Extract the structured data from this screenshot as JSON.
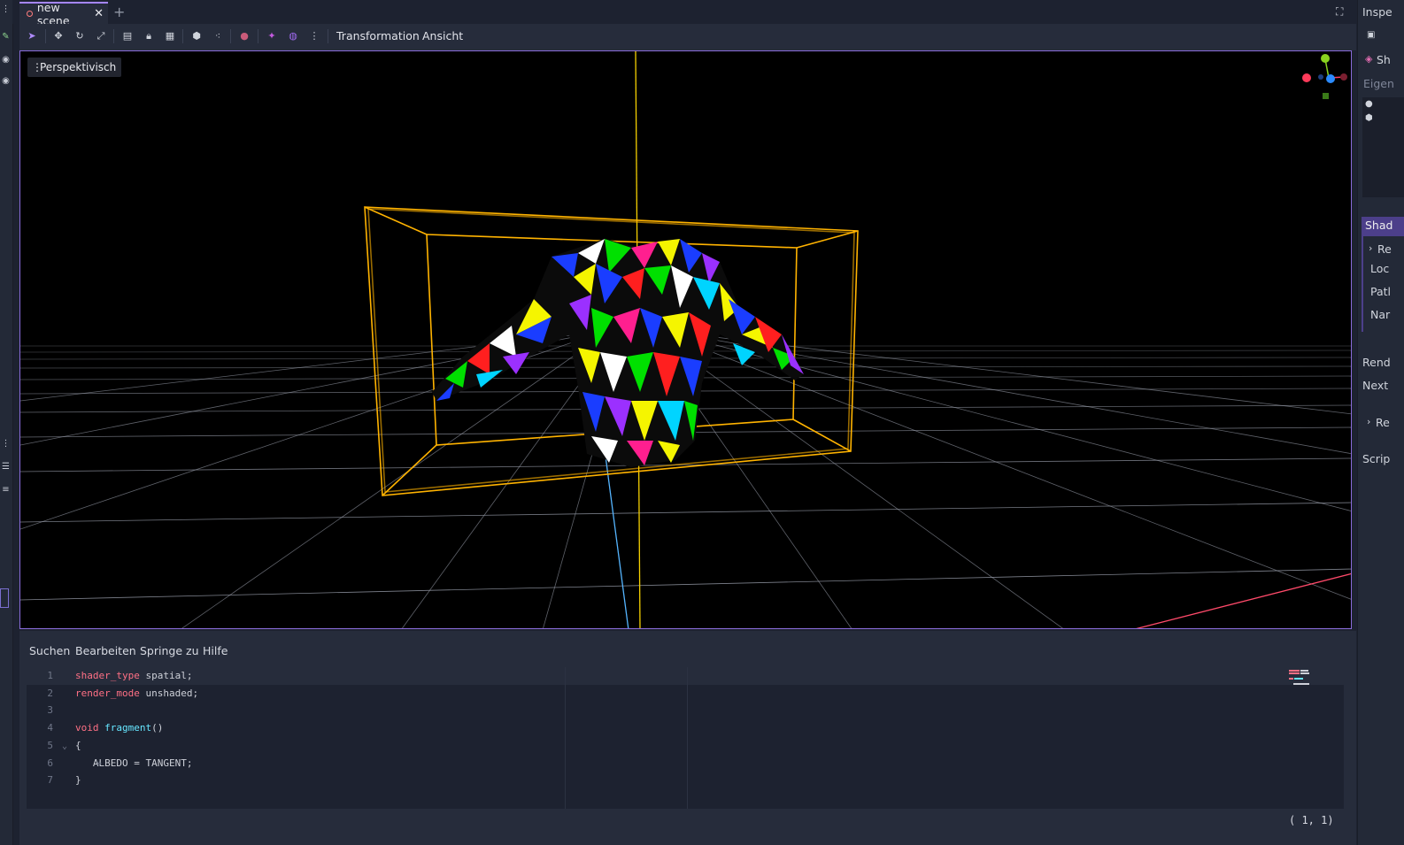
{
  "tabs": {
    "scene_tab_label": "new scene",
    "close_glyph": "✕",
    "add_glyph": "+"
  },
  "toolbar": {
    "menu_transform": "Transformation",
    "menu_view": "Ansicht",
    "icons": [
      "select-icon",
      "move-icon",
      "rotate-icon",
      "scale-icon",
      "list-select-icon",
      "lock-icon",
      "group-icon",
      "local-space-icon",
      "snap-icon",
      "camera-icon",
      "sun-icon",
      "environment-icon",
      "more-icon"
    ]
  },
  "viewport": {
    "mode_label": "Perspektivisch",
    "accent_color": "#8a6cdb",
    "selection_box_color": "#ffb300"
  },
  "inspector": {
    "title": "Inspe",
    "shader_row": "Sh",
    "properties_label": "Eigen",
    "shader_section": "Shad",
    "resource_row": "Re",
    "local_row": "Loc",
    "path_row": "Patl",
    "name_row": "Nar",
    "render_row": "Rend",
    "next_row": "Next",
    "resource_row_2": "Re",
    "script_row": "Scrip"
  },
  "shader_editor": {
    "menus": [
      "Suchen",
      "Bearbeiten",
      "Springe zu",
      "Hilfe"
    ],
    "code_lines": [
      {
        "n": "1",
        "parts": [
          {
            "t": "shader_type",
            "c": "kw"
          },
          {
            "t": " spatial;",
            "c": "tx"
          }
        ]
      },
      {
        "n": "2",
        "parts": [
          {
            "t": "render_mode",
            "c": "kw"
          },
          {
            "t": " unshaded;",
            "c": "tx"
          }
        ]
      },
      {
        "n": "3",
        "parts": []
      },
      {
        "n": "4",
        "parts": [
          {
            "t": "void",
            "c": "kw"
          },
          {
            "t": " ",
            "c": "tx"
          },
          {
            "t": "fragment",
            "c": "fn"
          },
          {
            "t": "()",
            "c": "tx"
          }
        ]
      },
      {
        "n": "5",
        "parts": [
          {
            "t": "{",
            "c": "tx"
          }
        ]
      },
      {
        "n": "6",
        "parts": [
          {
            "t": "»",
            "c": "ln"
          },
          {
            "t": "   ALBEDO = TANGENT;",
            "c": "tx"
          }
        ]
      },
      {
        "n": "7",
        "parts": [
          {
            "t": "}",
            "c": "tx"
          }
        ]
      }
    ],
    "caret_position": "(   1,   1)"
  }
}
